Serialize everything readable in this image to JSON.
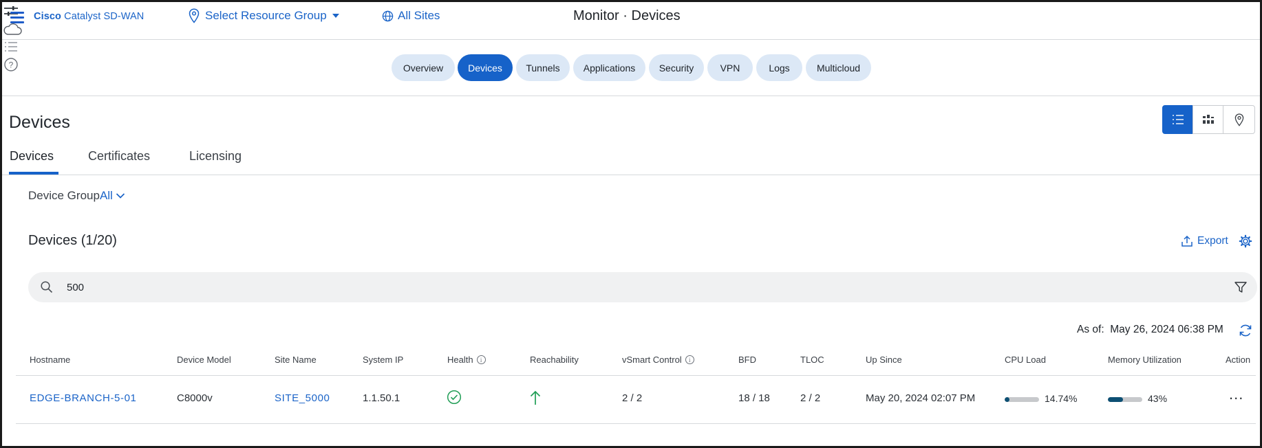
{
  "header": {
    "brand_bold": "Cisco",
    "brand_rest": "Catalyst SD-WAN",
    "resource_group": "Select Resource Group",
    "all_sites": "All Sites",
    "page_title_prefix": "Monitor",
    "page_title_separator": "·",
    "page_title_main": "Devices",
    "icons": [
      "menu-icon",
      "location-pin-icon",
      "globe-icon",
      "sliders-icon",
      "cloud-icon",
      "list-icon",
      "help-icon"
    ]
  },
  "nav": {
    "tabs": [
      {
        "label": "Overview",
        "active": false
      },
      {
        "label": "Devices",
        "active": true
      },
      {
        "label": "Tunnels",
        "active": false
      },
      {
        "label": "Applications",
        "active": false
      },
      {
        "label": "Security",
        "active": false
      },
      {
        "label": "VPN",
        "active": false
      },
      {
        "label": "Logs",
        "active": false
      },
      {
        "label": "Multicloud",
        "active": false
      }
    ]
  },
  "section": {
    "title": "Devices",
    "view_toggles": [
      {
        "icon": "list-view-icon",
        "active": true
      },
      {
        "icon": "grid-view-icon",
        "active": false
      },
      {
        "icon": "map-view-icon",
        "active": false
      }
    ]
  },
  "subtabs": [
    {
      "label": "Devices",
      "active": true
    },
    {
      "label": "Certificates",
      "active": false
    },
    {
      "label": "Licensing",
      "active": false
    }
  ],
  "filters": {
    "device_group_label": "Device Group",
    "device_group_value": "All"
  },
  "devices": {
    "count_label": "Devices (1/20)",
    "export_label": "Export",
    "search_value": "500",
    "as_of_label": "As of:",
    "as_of_value": "May 26, 2024 06:38 PM"
  },
  "table": {
    "columns": [
      "Hostname",
      "Device Model",
      "Site Name",
      "System IP",
      "Health",
      "Reachability",
      "vSmart Control",
      "BFD",
      "TLOC",
      "Up Since",
      "CPU Load",
      "Memory Utilization",
      "Action"
    ],
    "rows": [
      {
        "hostname": "EDGE-BRANCH-5-01",
        "device_model": "C8000v",
        "site_name": "SITE_5000",
        "system_ip": "1.1.50.1",
        "health": "healthy",
        "reachability": "reachable",
        "vsmart_control": "2 / 2",
        "bfd": "18 / 18",
        "tloc": "2 / 2",
        "up_since": "May 20, 2024 02:07 PM",
        "cpu_load": "14.74%",
        "cpu_fraction": 0.1474,
        "memory_utilization": "43%",
        "memory_fraction": 0.43,
        "action": "..."
      }
    ]
  },
  "colors": {
    "accent": "#1662c9",
    "pill_bg": "#dce8f6",
    "healthy": "#1f9d55",
    "bar_fill": "#0d4f73"
  }
}
